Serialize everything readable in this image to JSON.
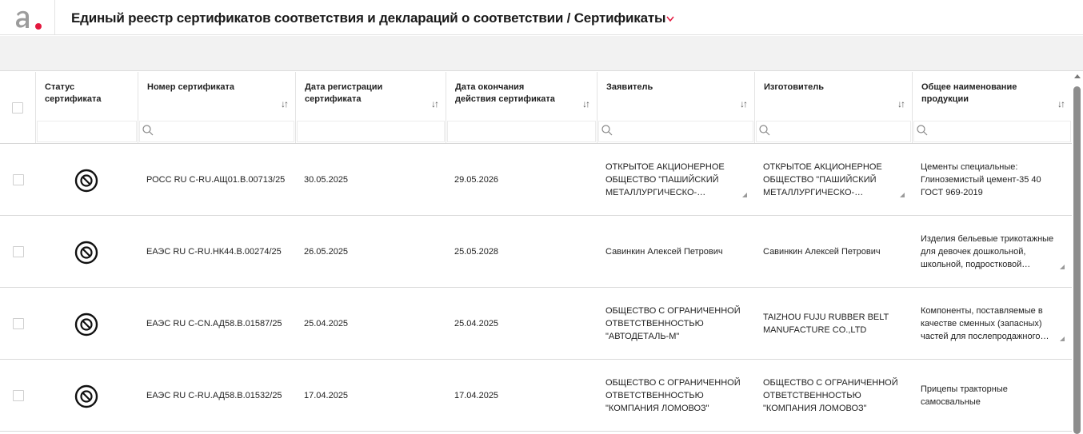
{
  "header": {
    "title": "Единый реестр сертификатов соответствия и деклараций о соответствии / Сертификаты"
  },
  "columns": [
    {
      "label": "Статус сертификата"
    },
    {
      "label": "Номер сертификата"
    },
    {
      "label": "Дата регистрации сертификата"
    },
    {
      "label": "Дата окончания действия сертификата"
    },
    {
      "label": "Заявитель"
    },
    {
      "label": "Изготовитель"
    },
    {
      "label": "Общее наименование продукции"
    }
  ],
  "rows": [
    {
      "status": "stop-icon",
      "number": "РОСС RU С-RU.АЩ01.В.00713/25",
      "reg_date": "30.05.2025",
      "end_date": "29.05.2026",
      "applicant": "ОТКРЫТОЕ АКЦИОНЕРНОЕ ОБЩЕСТВО \"ПАШИЙСКИЙ МЕТАЛЛУРГИЧЕСКО-ЦЕМЕНТНЫЙ ЗАВОД\"",
      "manufacturer": "ОТКРЫТОЕ АКЦИОНЕРНОЕ ОБЩЕСТВО \"ПАШИЙСКИЙ МЕТАЛЛУРГИЧЕСКО-ЦЕМЕНТНЫЙ ЗАВОД\"",
      "product": "Цементы специальные: Глиноземистый цемент-35 40 ГОСТ 969-2019"
    },
    {
      "status": "stop-icon",
      "number": "ЕАЭС RU С-RU.НК44.В.00274/25",
      "reg_date": "26.05.2025",
      "end_date": "25.05.2028",
      "applicant": "Савинкин Алексей Петрович",
      "manufacturer": "Савинкин Алексей Петрович",
      "product": "Изделия бельевые трикотажные для девочек дошкольной, школьной, подростковой возрастных групп из трикотажного полотна"
    },
    {
      "status": "stop-icon",
      "number": "ЕАЭС RU С-CN.АД58.В.01587/25",
      "reg_date": "25.04.2025",
      "end_date": "25.04.2025",
      "applicant": "ОБЩЕСТВО С ОГРАНИЧЕННОЙ ОТВЕТСТВЕННОСТЬЮ \"АВТОДЕТАЛЬ-М\"",
      "manufacturer": "TAIZHOU FUJU RUBBER BELT MANUFACTURE CO.,LTD",
      "product": "Компоненты, поставляемые в качестве сменных (запасных) частей для послепродажного технического обслуживания"
    },
    {
      "status": "stop-icon",
      "number": "ЕАЭС RU С-RU.АД58.В.01532/25",
      "reg_date": "17.04.2025",
      "end_date": "17.04.2025",
      "applicant": "ОБЩЕСТВО С ОГРАНИЧЕННОЙ ОТВЕТСТВЕННОСТЬЮ \"КОМПАНИЯ ЛОМОВОЗ\"",
      "manufacturer": "ОБЩЕСТВО С ОГРАНИЧЕННОЙ ОТВЕТСТВЕННОСТЬЮ \"КОМПАНИЯ ЛОМОВОЗ\"",
      "product": "Прицепы тракторные самосвальные"
    }
  ],
  "colors": {
    "accent": "#e3173e",
    "logo_gray": "#9c9c9c"
  }
}
